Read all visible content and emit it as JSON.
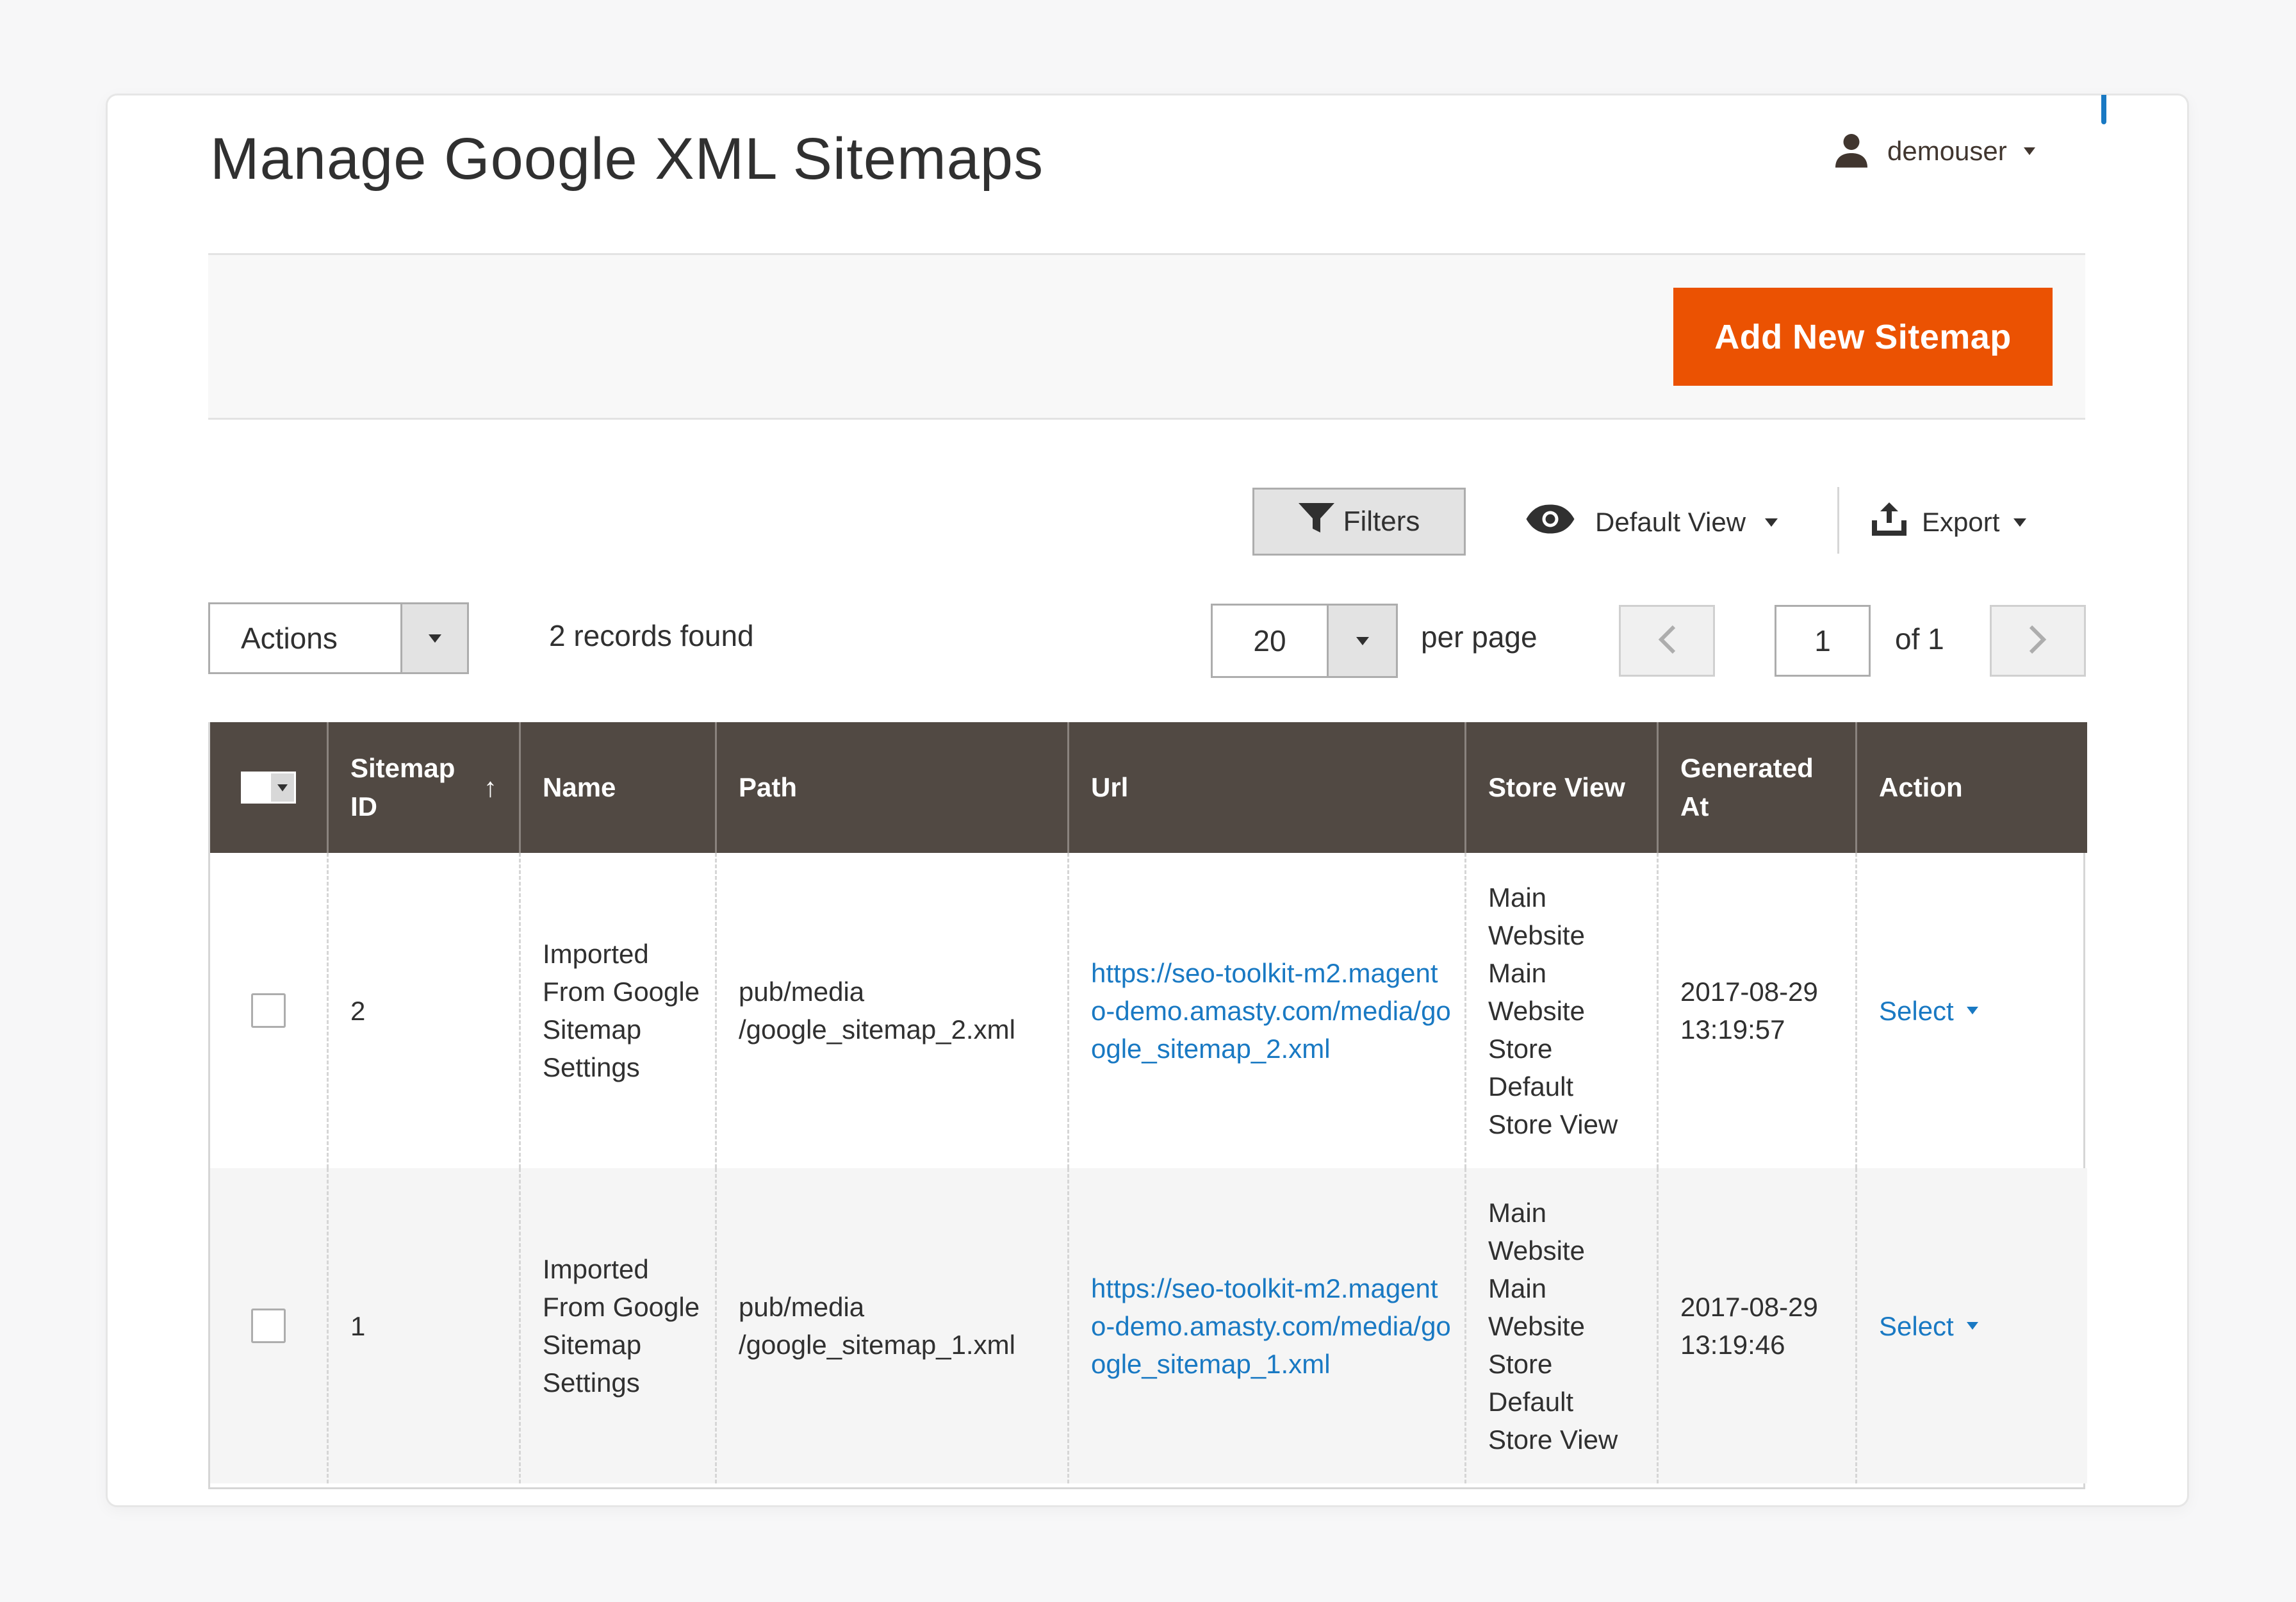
{
  "header": {
    "title": "Manage Google XML Sitemaps",
    "user": "demouser"
  },
  "page_actions": {
    "add_button": "Add New Sitemap"
  },
  "toolbar": {
    "filters": "Filters",
    "view": "Default View",
    "export": "Export",
    "actions": "Actions",
    "records": "2 records found",
    "per_page_value": "20",
    "per_page_label": "per page",
    "page": "1",
    "of_pages": "of 1"
  },
  "table": {
    "columns": [
      "Sitemap ID",
      "Name",
      "Path",
      "Url",
      "Store View",
      "Generated At",
      "Action"
    ],
    "sort_indicator": "↑",
    "rows": [
      {
        "id": "2",
        "name": "Imported From Google Sitemap Settings",
        "path": "pub/media /google_sitemap_2.xml",
        "url": "https://seo-toolkit-m2.magento-demo.amasty.com/media/google_sitemap_2.xml",
        "store_view": "Main\nWebsite\n   Main\nWebsite\nStore\n      Default\nStore View",
        "generated_at": "2017-08-29 13:19:57",
        "action": "Select"
      },
      {
        "id": "1",
        "name": "Imported From Google Sitemap Settings",
        "path": "pub/media /google_sitemap_1.xml",
        "url": "https://seo-toolkit-m2.magento-demo.amasty.com/media/google_sitemap_1.xml",
        "store_view": "Main\nWebsite\n   Main\nWebsite\nStore\n      Default\nStore View",
        "generated_at": "2017-08-29 13:19:46",
        "action": "Select"
      }
    ]
  },
  "colors": {
    "accent": "#eb5202",
    "header_bg": "#514943",
    "link": "#1979c3"
  },
  "icons": [
    "user-icon",
    "filter-icon",
    "eye-icon",
    "export-icon",
    "chevron-left-icon",
    "chevron-right-icon",
    "caret-down-icon"
  ]
}
